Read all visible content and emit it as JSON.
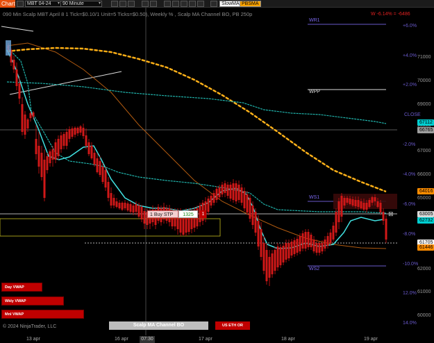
{
  "toolbar": {
    "chart_tab": "Chart",
    "instrument": "MBT 04-24",
    "interval": "90 Minute",
    "indicator1": "SlowMA",
    "indicator2": "PBSMA"
  },
  "chart": {
    "subtitle": "090 Min Scalp MBT April 8 1 Tick=$0.10/1 Unit=5 Ticks=$0.50), Weekly % , Scalp MA Channel BO, PB 250p",
    "pnl": "W -6.14% = -6486",
    "copyright": "© 2024 NinjaTrader, LLC",
    "order": {
      "label": "1 Buy STP",
      "qty": "1325",
      "close": "1"
    },
    "time_label": "07:30",
    "dates": [
      "13 apr",
      "16 apr",
      "17 apr",
      "18 apr",
      "19 apr"
    ],
    "levels": {
      "wr1": "WR1",
      "wpp": "WPP",
      "ws1": "WS1",
      "ws2": "WS2"
    }
  },
  "axis": {
    "prices": [
      "71000",
      "70000",
      "69000",
      "68000",
      "67000",
      "66000",
      "65000",
      "64000",
      "63000",
      "62000",
      "61000",
      "60000",
      "59000",
      "58000"
    ],
    "percents": [
      "+6.0%",
      "+4.0%",
      "+2.0%",
      "CLOSE",
      "-2.0%",
      "-4.0%",
      "-6.0%",
      "-8.0%",
      "-10.0%",
      "12.0%",
      "14.0%"
    ]
  },
  "price_tags": [
    {
      "text": "67112",
      "bg": "#00ced1",
      "fg": "#000"
    },
    {
      "text": "66765",
      "bg": "#9e9e9e",
      "fg": "#000"
    },
    {
      "text": "64016",
      "bg": "#ff8c00",
      "fg": "#000"
    },
    {
      "text": "63005",
      "bg": "#d8d8d8",
      "fg": "#000"
    },
    {
      "text": "62732",
      "bg": "#00ced1",
      "fg": "#000"
    },
    {
      "text": "61705",
      "bg": "#ffffff",
      "fg": "#000"
    },
    {
      "text": "61446",
      "bg": "#ff8c00",
      "fg": "#000"
    }
  ],
  "buttons": {
    "day_vwap": "Day VWAP",
    "wkly_vwap": "Wkly VWAP",
    "mnl_vwap": "Mnl VWAP",
    "scalp": "Scalp MA Channel BO",
    "us_eth": "US ETH OR"
  },
  "colors": {
    "bar": "#d01818",
    "upbar_wick": "#b01010",
    "cyan": "#40e0e0",
    "slow_ma": "#ffa500",
    "channel": "#20b2aa",
    "level_purple": "#6a5acd",
    "accent": "#e8500c"
  },
  "icons": [
    "chevron-down-icon",
    "close-x-icon"
  ]
}
